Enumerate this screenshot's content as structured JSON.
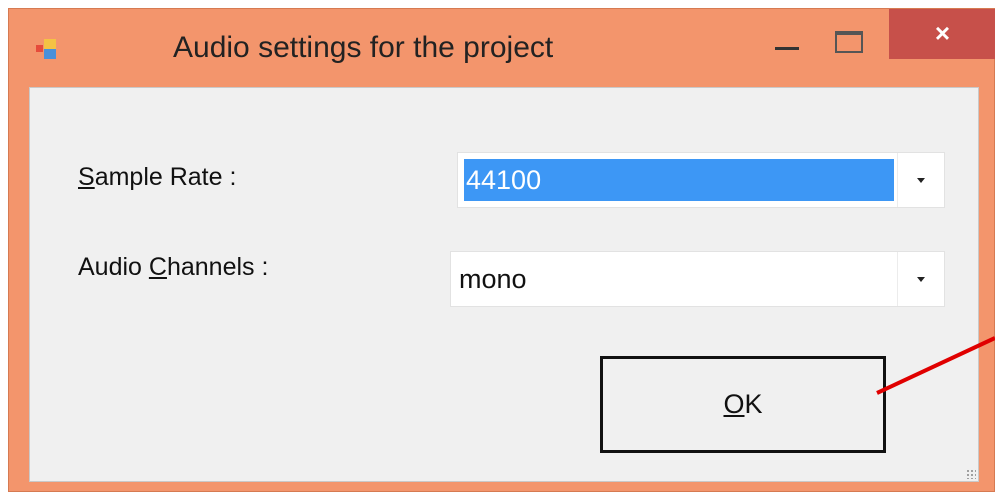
{
  "window": {
    "title": "Audio settings for the project",
    "close_glyph": "×",
    "accent": "#f3956c",
    "close_color": "#c7504a"
  },
  "form": {
    "sample_rate_label_mnemonic": "S",
    "sample_rate_label_rest": "ample Rate :",
    "sample_rate_value": "44100",
    "channels_label_pre": "Audio ",
    "channels_label_mnemonic": "C",
    "channels_label_rest": "hannels :",
    "channels_value": "mono",
    "selection_color": "#3d97f5"
  },
  "buttons": {
    "ok_mnemonic": "O",
    "ok_rest": "K"
  },
  "icons": {
    "app": "app-window-icon",
    "minimize": "minimize-icon",
    "maximize": "maximize-icon",
    "close": "close-icon",
    "dropdown": "chevron-down-icon"
  }
}
